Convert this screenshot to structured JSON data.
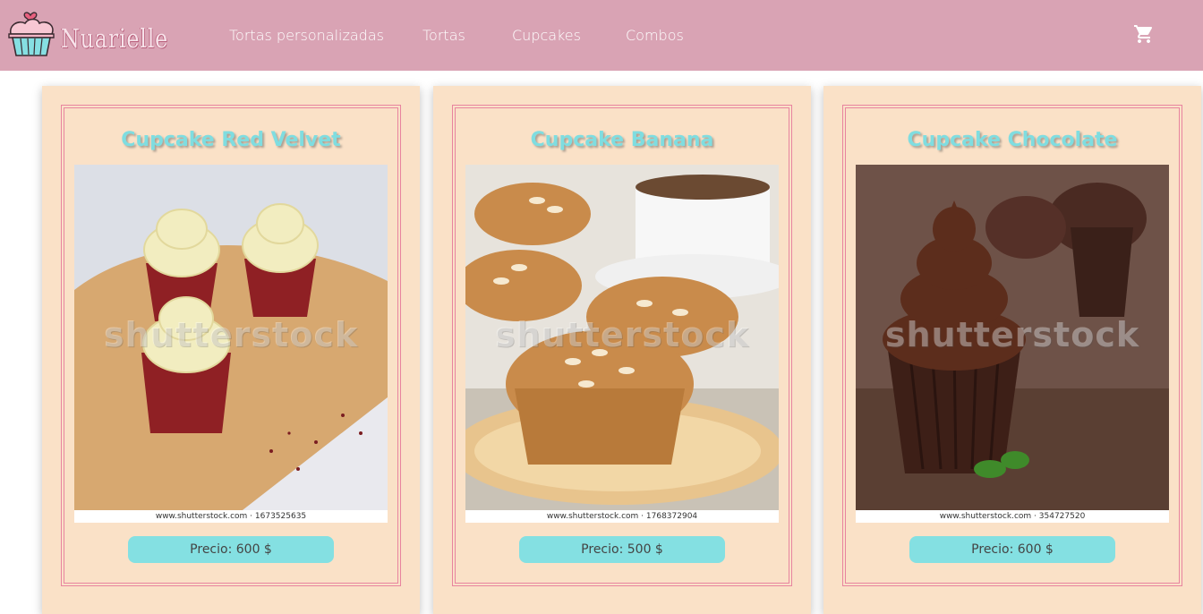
{
  "brand": {
    "name": "Nuarielle"
  },
  "nav": {
    "links": [
      "Tortas personalizadas",
      "Tortas",
      "Cupcakes",
      "Combos"
    ],
    "cart_icon": "shopping-cart-icon"
  },
  "colors": {
    "navbar": "#d9a3b4",
    "card_bg": "#fae1c7",
    "frame": "#e8849f",
    "title": "#7fdde0",
    "price_button": "#84e0e2"
  },
  "products": [
    {
      "title": "Cupcake Red Velvet",
      "price": "Precio: 600 $",
      "watermark": "shutterstock",
      "image_caption": "www.shutterstock.com · 1673525635"
    },
    {
      "title": "Cupcake Banana",
      "price": "Precio: 500 $",
      "watermark": "shutterstock",
      "image_caption": "www.shutterstock.com · 1768372904"
    },
    {
      "title": "Cupcake Chocolate",
      "price": "Precio: 600 $",
      "watermark": "shutterstock",
      "image_caption": "www.shutterstock.com · 354727520"
    }
  ]
}
